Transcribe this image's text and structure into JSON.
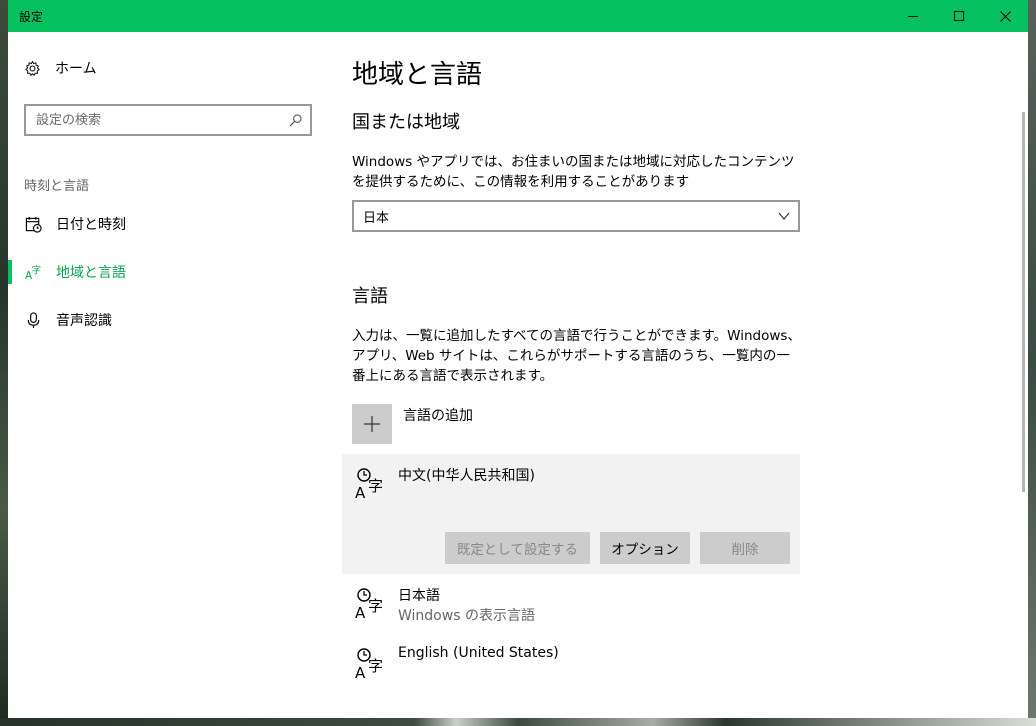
{
  "window": {
    "title": "設定"
  },
  "sidebar": {
    "home_label": "ホーム",
    "search_placeholder": "設定の検索",
    "section_caption": "時刻と言語",
    "items": [
      {
        "label": "日付と時刻",
        "icon": "calendar-clock-icon",
        "active": false
      },
      {
        "label": "地域と言語",
        "icon": "language-region-icon",
        "active": true
      },
      {
        "label": "音声認識",
        "icon": "microphone-icon",
        "active": false
      }
    ]
  },
  "main": {
    "page_title": "地域と言語",
    "region": {
      "heading": "国または地域",
      "description": "Windows やアプリでは、お住まいの国または地域に対応したコンテンツを提供するために、この情報を利用することがあります",
      "selected_country": "日本"
    },
    "language": {
      "heading": "言語",
      "description": "入力は、一覧に追加したすべての言語で行うことができます。Windows、アプリ、Web サイトは、これらがサポートする言語のうち、一覧内の一番上にある言語で表示されます。",
      "add_label": "言語の追加",
      "items": [
        {
          "name": "中文(中华人民共和国)",
          "sub": ""
        },
        {
          "name": "日本語",
          "sub": "Windows の表示言語"
        },
        {
          "name": "English (United States)",
          "sub": ""
        }
      ],
      "buttons": {
        "set_default": "既定として設定する",
        "options": "オプション",
        "remove": "削除"
      }
    }
  },
  "colors": {
    "accent": "#07c160",
    "accent_text": "#07a552"
  }
}
